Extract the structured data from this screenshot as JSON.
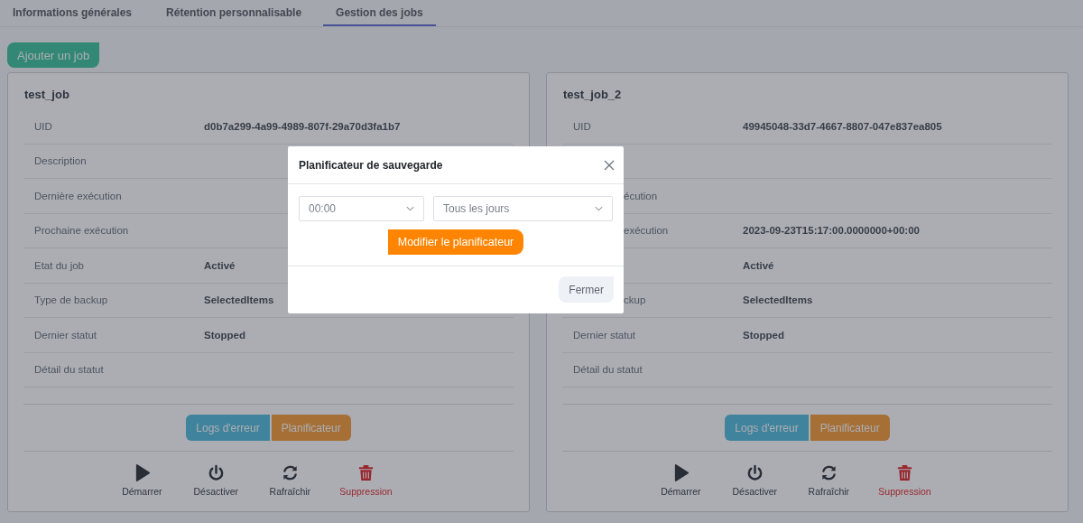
{
  "tabs": [
    {
      "label": "Informations générales",
      "selected": false
    },
    {
      "label": "Rétention personnalisable",
      "selected": false
    },
    {
      "label": "Gestion des jobs",
      "selected": true
    }
  ],
  "add_button": "Ajouter un job",
  "jobs": [
    {
      "title": "test_job",
      "rows": [
        {
          "label": "UID",
          "value": "d0b7a299-4a99-4989-807f-29a70d3fa1b7"
        },
        {
          "label": "Description"
        },
        {
          "label": "Dernière exécution"
        },
        {
          "label": "Prochaine exécution"
        },
        {
          "label": "Etat du job",
          "value": "Activé"
        },
        {
          "label": "Type de backup",
          "value": "SelectedItems"
        },
        {
          "label": "Dernier statut",
          "value": "Stopped"
        },
        {
          "label": "Détail du statut"
        }
      ],
      "buttons": [
        {
          "label": "Logs d'erreur",
          "kind": "info"
        },
        {
          "label": "Planificateur",
          "kind": "warning"
        }
      ],
      "actions": [
        {
          "label": "Démarrer",
          "kind": "start"
        },
        {
          "label": "Désactiver",
          "kind": "power"
        },
        {
          "label": "Rafraîchir",
          "kind": "refresh"
        },
        {
          "label": "Suppression",
          "kind": "delete"
        }
      ]
    },
    {
      "title": "test_job_2",
      "rows": [
        {
          "label": "UID",
          "value": "49945048-33d7-4667-8807-047e837ea805"
        },
        {},
        {
          "label": "écution",
          "cut": true
        },
        {
          "label": "exécution",
          "cut": true,
          "value": "2023-09-23T15:17:00.0000000+00:00"
        },
        {
          "value": "Activé"
        },
        {
          "label": "ckup",
          "cut": true,
          "value": "SelectedItems"
        },
        {
          "label": "Dernier statut",
          "value": "Stopped"
        },
        {
          "label": "Détail du statut"
        }
      ],
      "buttons": [
        {
          "label": "Logs d'erreur",
          "kind": "info"
        },
        {
          "label": "Planificateur",
          "kind": "warning"
        }
      ],
      "actions": [
        {
          "label": "Démarrer",
          "kind": "start"
        },
        {
          "label": "Désactiver",
          "kind": "power"
        },
        {
          "label": "Rafraîchir",
          "kind": "refresh"
        },
        {
          "label": "Suppression",
          "kind": "delete"
        }
      ]
    }
  ],
  "modal": {
    "title": "Planificateur de sauvegarde",
    "fields": [
      {
        "value": "00:00"
      },
      {
        "value": "Tous les jours"
      }
    ],
    "submit": "Modifier le planificateur",
    "close_button": "Fermer"
  }
}
